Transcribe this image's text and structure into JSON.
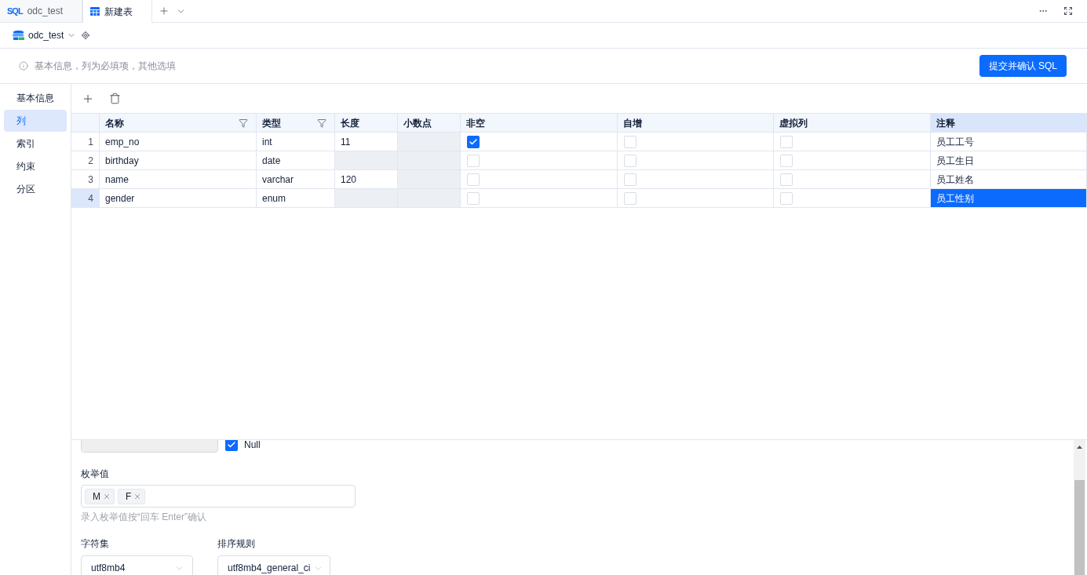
{
  "tabs": [
    {
      "kind": "sql",
      "icon_text": "SQL",
      "label": "odc_test",
      "selected": false
    },
    {
      "kind": "table",
      "label": "新建表",
      "selected": true
    }
  ],
  "connection": {
    "label": "odc_test"
  },
  "notice": {
    "text": "基本信息，列为必填项，其他选填"
  },
  "submit_button": {
    "label": "提交并确认 SQL"
  },
  "sidebar": {
    "items": [
      {
        "label": "基本信息",
        "selected": false
      },
      {
        "label": "列",
        "selected": true
      },
      {
        "label": "索引",
        "selected": false
      },
      {
        "label": "约束",
        "selected": false
      },
      {
        "label": "分区",
        "selected": false
      }
    ]
  },
  "table": {
    "columns": [
      {
        "label": "名称",
        "kind": "text",
        "filter": true,
        "selected": false
      },
      {
        "label": "类型",
        "kind": "text",
        "filter": true,
        "selected": false
      },
      {
        "label": "长度",
        "kind": "text",
        "filter": false,
        "selected": false
      },
      {
        "label": "小数点",
        "kind": "text",
        "filter": false,
        "selected": false
      },
      {
        "label": "非空",
        "kind": "checkbox",
        "filter": false,
        "selected": false
      },
      {
        "label": "自增",
        "kind": "checkbox",
        "filter": false,
        "selected": false
      },
      {
        "label": "虚拟列",
        "kind": "checkbox",
        "filter": false,
        "selected": false
      },
      {
        "label": "注释",
        "kind": "text",
        "filter": false,
        "selected": true
      }
    ],
    "rows": [
      {
        "number": "1",
        "selected": false,
        "cells": [
          {
            "text": "emp_no"
          },
          {
            "text": "int"
          },
          {
            "text": "11",
            "disabled": false
          },
          {
            "disabled": true
          },
          {
            "checked": true
          },
          {
            "checked": false
          },
          {
            "checked": false
          },
          {
            "text": "员工工号"
          }
        ]
      },
      {
        "number": "2",
        "selected": false,
        "cells": [
          {
            "text": "birthday"
          },
          {
            "text": "date"
          },
          {
            "disabled": true
          },
          {
            "disabled": true
          },
          {
            "checked": false
          },
          {
            "checked": false
          },
          {
            "checked": false
          },
          {
            "text": "员工生日"
          }
        ]
      },
      {
        "number": "3",
        "selected": false,
        "cells": [
          {
            "text": "name"
          },
          {
            "text": "varchar"
          },
          {
            "text": "120",
            "disabled": false
          },
          {
            "disabled": true
          },
          {
            "checked": false
          },
          {
            "checked": false
          },
          {
            "checked": false
          },
          {
            "text": "员工姓名"
          }
        ]
      },
      {
        "number": "4",
        "selected": true,
        "cells": [
          {
            "text": "gender"
          },
          {
            "text": "enum"
          },
          {
            "disabled": true
          },
          {
            "disabled": true
          },
          {
            "checked": false
          },
          {
            "checked": false
          },
          {
            "checked": false
          },
          {
            "text": "员工性别"
          }
        ]
      }
    ]
  },
  "detail": {
    "default_field": {
      "disabled": true
    },
    "null_option": {
      "label": "Null",
      "checked": true
    },
    "enum_values": {
      "label": "枚举值",
      "tags": [
        "M",
        "F"
      ],
      "hint": "录入枚举值按“回车 Enter”确认"
    },
    "charset": {
      "label": "字符集",
      "value": "utf8mb4"
    },
    "collation": {
      "label": "排序规则",
      "value": "utf8mb4_general_ci"
    }
  }
}
